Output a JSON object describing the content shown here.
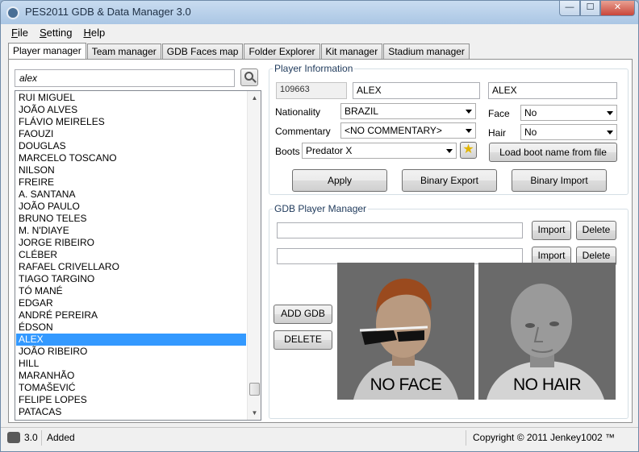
{
  "window": {
    "title": "PES2011 GDB & Data Manager 3.0",
    "controls": {
      "minimize": "—",
      "maximize": "☐",
      "close": "✕"
    }
  },
  "menu": {
    "items": [
      {
        "first": "F",
        "rest": "ile"
      },
      {
        "first": "S",
        "rest": "etting"
      },
      {
        "first": "H",
        "rest": "elp"
      }
    ]
  },
  "tabs": [
    {
      "label": "Player manager",
      "active": true
    },
    {
      "label": "Team manager"
    },
    {
      "label": "GDB Faces map"
    },
    {
      "label": "Folder Explorer"
    },
    {
      "label": "Kit manager"
    },
    {
      "label": "Stadium manager"
    }
  ],
  "search": {
    "value": "alex",
    "icon": "search-icon"
  },
  "players": [
    "RUI MIGUEL",
    "JOÃO ALVES",
    "FLÁVIO MEIRELES",
    "FAOUZI",
    "DOUGLAS",
    "MARCELO TOSCANO",
    "NILSON",
    "FREIRE",
    "A. SANTANA",
    "JOÃO PAULO",
    "BRUNO TELES",
    "M. N'DIAYE",
    "JORGE RIBEIRO",
    "CLÉBER",
    "RAFAEL CRIVELLARO",
    "TIAGO TARGINO",
    "TÓ MANÉ",
    "EDGAR",
    "ANDRÉ PEREIRA",
    "ÉDSON",
    "ALEX",
    "JOÃO RIBEIRO",
    "HILL",
    "MARANHÃO",
    "TOMAŠEVIĆ",
    "FELIPE LOPES",
    "PATACAS"
  ],
  "selected_player": "ALEX",
  "player_info": {
    "legend": "Player Information",
    "id": "109663",
    "name": "ALEX",
    "shirt_name": "ALEX",
    "nationality_label": "Nationality",
    "nationality": "BRAZIL",
    "commentary_label": "Commentary",
    "commentary": "<NO COMMENTARY>",
    "boots_label": "Boots",
    "boots": "Predator X",
    "face_label": "Face",
    "face": "No",
    "hair_label": "Hair",
    "hair": "No",
    "load_boot_label": "Load boot name from file",
    "apply_label": "Apply",
    "binary_export_label": "Binary Export",
    "binary_import_label": "Binary Import"
  },
  "gdb": {
    "legend": "GDB Player Manager",
    "face_path": "",
    "hair_path": "",
    "import_label": "Import",
    "delete_label": "Delete",
    "add_gdb_label": "ADD GDB",
    "delete_gdb_label": "DELETE",
    "no_face_caption": "NO FACE",
    "no_hair_caption": "NO HAIR"
  },
  "status": {
    "version": "3.0",
    "message": "Added",
    "copyright": "Copyright © 2011 Jenkey1002 ™"
  }
}
